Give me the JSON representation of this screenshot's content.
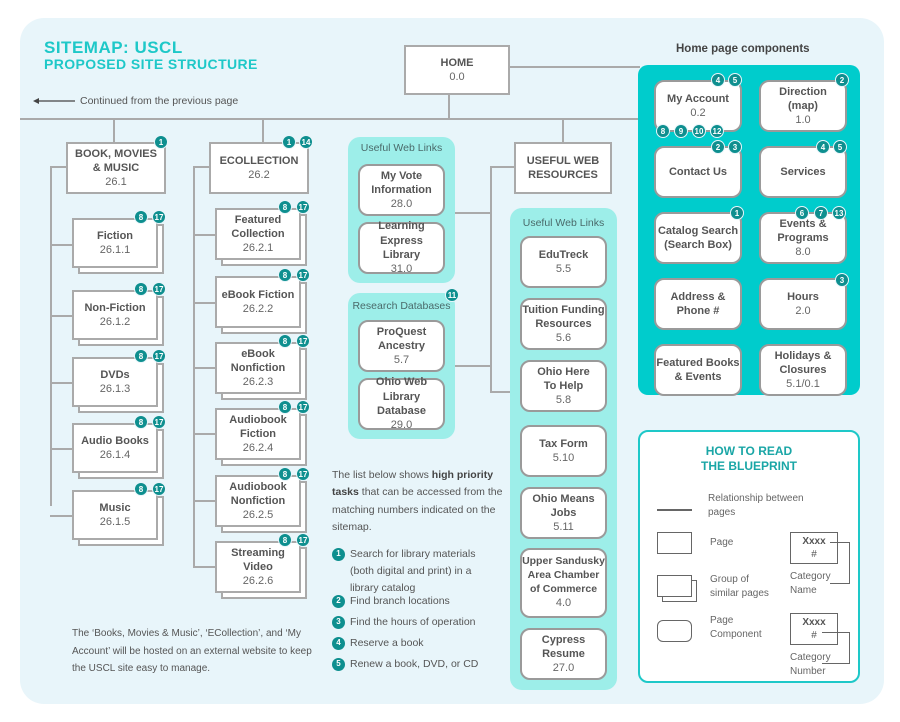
{
  "title": {
    "line1": "SITEMAP: USCL",
    "line2": "PROPOSED SITE STRUCTURE"
  },
  "continued_label": "Continued from the previous page",
  "colors": {
    "accent": "#1ec8c8",
    "badge": "#0e8f8f",
    "panel_bg": "#e8f5fa",
    "component_panel": "#00cccc",
    "link_group": "#9deee9",
    "line": "#aaaaaa"
  },
  "home": {
    "name": "HOME",
    "number": "0.0"
  },
  "books": {
    "name": "BOOK, MOVIES & MUSIC",
    "number": "26.1",
    "badges": [
      "1"
    ],
    "children": [
      {
        "name": "Fiction",
        "number": "26.1.1",
        "badges": [
          "8",
          "17"
        ]
      },
      {
        "name": "Non-Fiction",
        "number": "26.1.2",
        "badges": [
          "8",
          "17"
        ]
      },
      {
        "name": "DVDs",
        "number": "26.1.3",
        "badges": [
          "8",
          "17"
        ]
      },
      {
        "name": "Audio Books",
        "number": "26.1.4",
        "badges": [
          "8",
          "17"
        ]
      },
      {
        "name": "Music",
        "number": "26.1.5",
        "badges": [
          "8",
          "17"
        ]
      }
    ]
  },
  "ecollection": {
    "name": "ECOLLECTION",
    "number": "26.2",
    "badges": [
      "1",
      "14"
    ],
    "children": [
      {
        "name": "Featured Collection",
        "number": "26.2.1",
        "badges": [
          "8",
          "17"
        ]
      },
      {
        "name": "eBook Fiction",
        "number": "26.2.2",
        "badges": [
          "8",
          "17"
        ]
      },
      {
        "name": "eBook Nonfiction",
        "number": "26.2.3",
        "badges": [
          "8",
          "17"
        ]
      },
      {
        "name": "Audiobook Fiction",
        "number": "26.2.4",
        "badges": [
          "8",
          "17"
        ]
      },
      {
        "name": "Audiobook Nonfiction",
        "number": "26.2.5",
        "badges": [
          "8",
          "17"
        ]
      },
      {
        "name": "Streaming Video",
        "number": "26.2.6",
        "badges": [
          "8",
          "17"
        ]
      }
    ]
  },
  "useful_links_left": {
    "header": "Useful Web Links",
    "items": [
      {
        "name": "My Vote Information",
        "number": "28.0"
      },
      {
        "name": "Learning Express Library",
        "number": "31.0"
      }
    ]
  },
  "research_databases": {
    "header": "Research Databases",
    "badges": [
      "11"
    ],
    "items": [
      {
        "name": "ProQuest Ancestry",
        "number": "5.7"
      },
      {
        "name": "Ohio Web Library Database",
        "number": "29.0"
      }
    ]
  },
  "useful_web_resources": {
    "name": "USEFUL WEB RESOURCES"
  },
  "useful_links_right": {
    "header": "Useful Web Links",
    "items": [
      {
        "name": "EduTreck",
        "number": "5.5"
      },
      {
        "name": "Tuition Funding Resources",
        "number": "5.6"
      },
      {
        "name": "Ohio Here To Help",
        "number": "5.8"
      },
      {
        "name": "Tax Form",
        "number": "5.10"
      },
      {
        "name": "Ohio Means Jobs",
        "number": "5.11"
      },
      {
        "name": "Upper Sandusky Area Chamber of Commerce",
        "number": "4.0"
      },
      {
        "name": "Cypress Resume",
        "number": "27.0"
      }
    ]
  },
  "home_components": {
    "title": "Home page components",
    "items": [
      {
        "name": "My Account",
        "number": "0.2",
        "badges": [
          "4",
          "5"
        ],
        "bottom_badges": [
          "8",
          "9",
          "10",
          "12"
        ]
      },
      {
        "name": "Direction (map)",
        "number": "1.0",
        "badges": [
          "2"
        ]
      },
      {
        "name": "Contact Us",
        "number": "",
        "badges": [
          "2",
          "3"
        ]
      },
      {
        "name": "Services",
        "number": "",
        "badges": [
          "4",
          "5"
        ]
      },
      {
        "name": "Catalog Search (Search Box)",
        "number": "",
        "badges": [
          "1"
        ]
      },
      {
        "name": "Events & Programs",
        "number": "8.0",
        "badges": [
          "6",
          "7",
          "13"
        ]
      },
      {
        "name": "Address & Phone #",
        "number": "",
        "badges": []
      },
      {
        "name": "Hours",
        "number": "2.0",
        "badges": [
          "3"
        ]
      },
      {
        "name": "Featured Books & Events",
        "number": "",
        "badges": []
      },
      {
        "name": "Holidays & Closures",
        "number": "5.1/0.1",
        "badges": []
      }
    ]
  },
  "legend": {
    "title_line1": "HOW TO READ",
    "title_line2": "THE BLUEPRINT",
    "relationship": "Relationship between pages",
    "page": "Page",
    "group": "Group of similar pages",
    "component": "Page Component",
    "sample_name": "Xxxx",
    "sample_number": "#",
    "category_name": "Category Name",
    "category_number": "Category Number"
  },
  "tasks": {
    "intro_pre": "The list below shows ",
    "intro_bold": "high priority tasks",
    "intro_post": " that can be accessed from the matching numbers indicated on the sitemap.",
    "items": [
      {
        "n": "1",
        "text": "Search for library materials (both digital and print) in a library catalog"
      },
      {
        "n": "2",
        "text": "Find branch locations"
      },
      {
        "n": "3",
        "text": "Find the hours of operation"
      },
      {
        "n": "4",
        "text": "Reserve a book"
      },
      {
        "n": "5",
        "text": "Renew a book, DVD, or CD"
      }
    ]
  },
  "note": "The ‘Books, Movies & Music’, ‘ECollection’, and ‘My Account’ will be hosted on an external website to keep the USCL site easy to manage."
}
